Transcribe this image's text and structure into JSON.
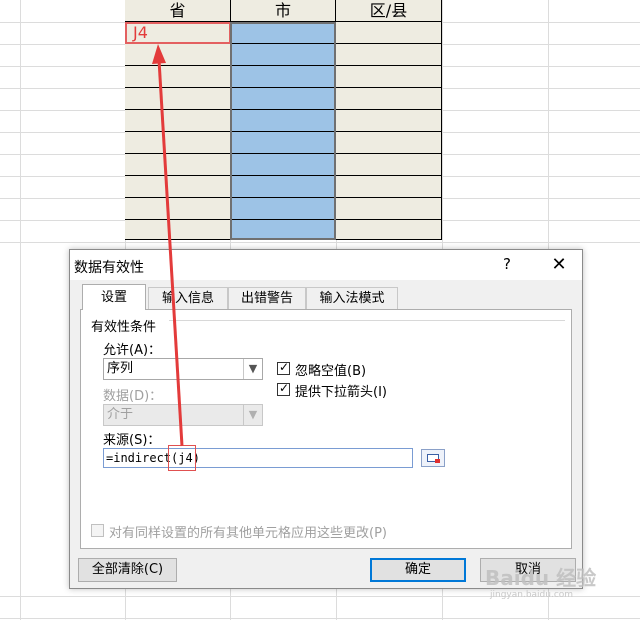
{
  "spreadsheet": {
    "headers": [
      "省",
      "市",
      "区/县"
    ],
    "selected_cell_text": "J4",
    "accent_red": "#e33b3b",
    "blue_fill": "#9dc3e6",
    "beige_fill": "#eeece1"
  },
  "dialog": {
    "title": "数据有效性",
    "help_label": "?",
    "close_label": "✕",
    "tabs": [
      {
        "label": "设置",
        "active": true
      },
      {
        "label": "输入信息",
        "active": false
      },
      {
        "label": "出错警告",
        "active": false
      },
      {
        "label": "输入法模式",
        "active": false
      }
    ],
    "group_label": "有效性条件",
    "allow_label": "允许(A)：",
    "allow_value": "序列",
    "data_label": "数据(D)：",
    "data_value": "介于",
    "ignore_blank_label": "忽略空值(B)",
    "ignore_blank_checked": true,
    "dropdown_label": "提供下拉箭头(I)",
    "dropdown_checked": true,
    "source_label": "来源(S)：",
    "source_value": "=indirect(j4)",
    "apply_all_label": "对有同样设置的所有其他单元格应用这些更改(P)",
    "apply_all_checked": false,
    "clear_all_button": "全部清除(C)",
    "ok_button": "确定",
    "cancel_button": "取消"
  },
  "watermark": {
    "text": "Baidu 经验",
    "url": "jingyan.baidu.com"
  }
}
